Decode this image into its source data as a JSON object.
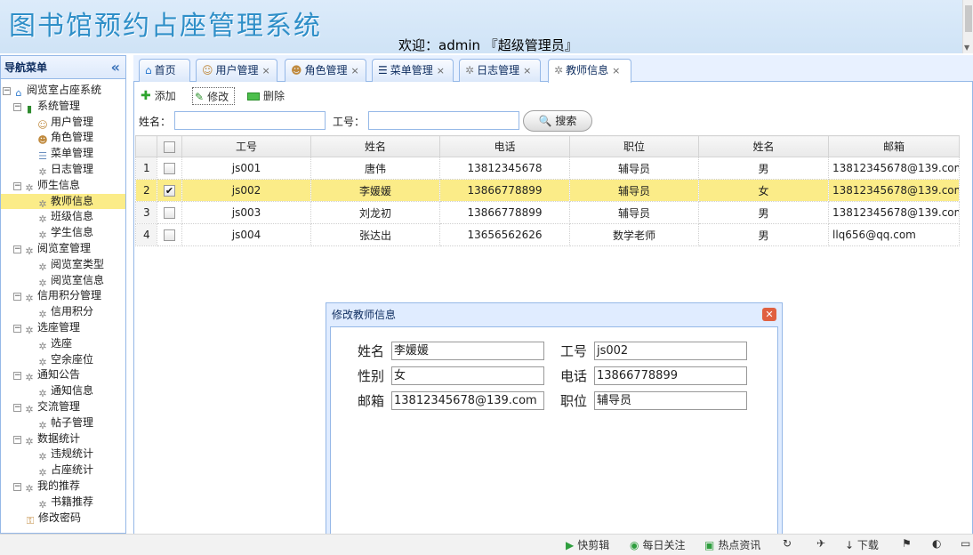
{
  "header": {
    "app_title": "图书馆预约占座管理系统",
    "welcome": "欢迎：admin 『超级管理员』"
  },
  "sidebar": {
    "title": "导航菜单",
    "collapse_icon": "«",
    "tree": [
      {
        "label": "阅览室占座系统",
        "level": 0,
        "icon": "home-icon"
      },
      {
        "label": "系统管理",
        "level": 1,
        "icon": "book-icon"
      },
      {
        "label": "用户管理",
        "level": 2,
        "icon": "user-icon"
      },
      {
        "label": "角色管理",
        "level": 2,
        "icon": "users-icon"
      },
      {
        "label": "菜单管理",
        "level": 2,
        "icon": "menu-icon"
      },
      {
        "label": "日志管理",
        "level": 2,
        "icon": "gear-icon"
      },
      {
        "label": "师生信息",
        "level": 1,
        "icon": "gear-icon"
      },
      {
        "label": "教师信息",
        "level": 2,
        "icon": "gear-icon",
        "selected": true
      },
      {
        "label": "班级信息",
        "level": 2,
        "icon": "gear-icon"
      },
      {
        "label": "学生信息",
        "level": 2,
        "icon": "gear-icon"
      },
      {
        "label": "阅览室管理",
        "level": 1,
        "icon": "gear-icon"
      },
      {
        "label": "阅览室类型",
        "level": 2,
        "icon": "gear-icon"
      },
      {
        "label": "阅览室信息",
        "level": 2,
        "icon": "gear-icon"
      },
      {
        "label": "信用积分管理",
        "level": 1,
        "icon": "gear-icon"
      },
      {
        "label": "信用积分",
        "level": 2,
        "icon": "gear-icon"
      },
      {
        "label": "选座管理",
        "level": 1,
        "icon": "gear-icon"
      },
      {
        "label": "选座",
        "level": 2,
        "icon": "gear-icon"
      },
      {
        "label": "空余座位",
        "level": 2,
        "icon": "gear-icon"
      },
      {
        "label": "通知公告",
        "level": 1,
        "icon": "gear-icon"
      },
      {
        "label": "通知信息",
        "level": 2,
        "icon": "gear-icon"
      },
      {
        "label": "交流管理",
        "level": 1,
        "icon": "gear-icon"
      },
      {
        "label": "帖子管理",
        "level": 2,
        "icon": "gear-icon"
      },
      {
        "label": "数据统计",
        "level": 1,
        "icon": "gear-icon"
      },
      {
        "label": "违规统计",
        "level": 2,
        "icon": "gear-icon"
      },
      {
        "label": "占座统计",
        "level": 2,
        "icon": "gear-icon"
      },
      {
        "label": "我的推荐",
        "level": 1,
        "icon": "gear-icon"
      },
      {
        "label": "书籍推荐",
        "level": 2,
        "icon": "gear-icon"
      },
      {
        "label": "修改密码",
        "level": 1,
        "icon": "key-icon"
      }
    ]
  },
  "tabs": [
    {
      "label": "首页",
      "closable": false,
      "icon": "home-icon"
    },
    {
      "label": "用户管理",
      "closable": true,
      "icon": "user-icon"
    },
    {
      "label": "角色管理",
      "closable": true,
      "icon": "users-icon"
    },
    {
      "label": "菜单管理",
      "closable": true,
      "icon": "menu-icon"
    },
    {
      "label": "日志管理",
      "closable": true,
      "icon": "gear-icon"
    },
    {
      "label": "教师信息",
      "closable": true,
      "icon": "gear-icon",
      "active": true
    }
  ],
  "toolbar": {
    "add_label": "添加",
    "edit_label": "修改",
    "delete_label": "删除"
  },
  "search": {
    "name_label": "姓名：",
    "name_value": "",
    "id_label": "工号：",
    "id_value": "",
    "button_label": "搜索"
  },
  "grid": {
    "columns": [
      "工号",
      "姓名",
      "电话",
      "职位",
      "姓名",
      "邮箱"
    ],
    "rows": [
      {
        "num": "1",
        "checked": false,
        "cells": [
          "js001",
          "唐伟",
          "13812345678",
          "辅导员",
          "男",
          "13812345678@139.com"
        ]
      },
      {
        "num": "2",
        "checked": true,
        "selected": true,
        "cells": [
          "js002",
          "李媛媛",
          "13866778899",
          "辅导员",
          "女",
          "13812345678@139.com"
        ]
      },
      {
        "num": "3",
        "checked": false,
        "cells": [
          "js003",
          "刘龙初",
          "13866778899",
          "辅导员",
          "男",
          "13812345678@139.com"
        ]
      },
      {
        "num": "4",
        "checked": false,
        "cells": [
          "js004",
          "张达出",
          "13656562626",
          "数学老师",
          "男",
          "llq656@qq.com"
        ]
      }
    ]
  },
  "dialog": {
    "title": "修改教师信息",
    "name_label": "姓名",
    "name_value": "李媛媛",
    "id_label": "工号",
    "id_value": "js002",
    "gender_label": "性别",
    "gender_value": "女",
    "phone_label": "电话",
    "phone_value": "13866778899",
    "email_label": "邮箱",
    "email_value": "13812345678@139.com",
    "position_label": "职位",
    "position_value": "辅导员"
  },
  "statusbar": {
    "items": [
      "快剪辑",
      "每日关注",
      "热点资讯",
      "下载"
    ]
  }
}
